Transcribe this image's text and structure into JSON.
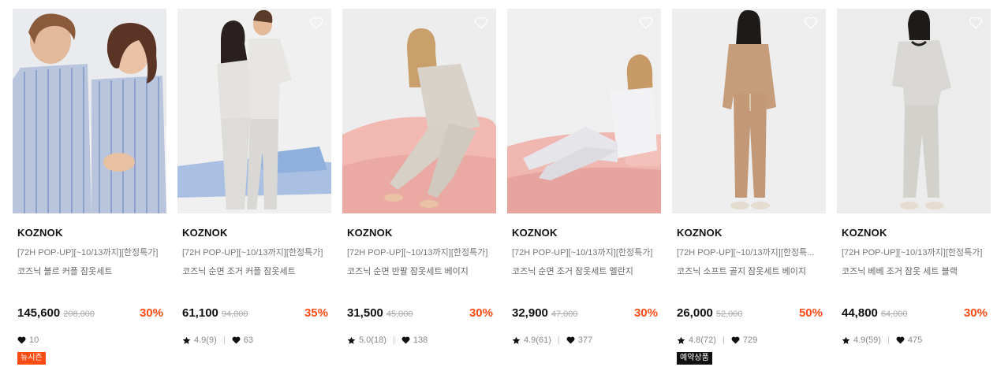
{
  "accent_color": "#ff4b14",
  "products": [
    {
      "brand": "KOZNOK",
      "tag": "[72H POP-UP][~10/13까지][한정특가]",
      "name": "코즈닉 블르 커플 잠옷세트",
      "price": "145,600",
      "original_price": "208,000",
      "discount": "30%",
      "rating": "",
      "likes": "10",
      "badge": "뉴시즌",
      "badge_color": "#ff4b14"
    },
    {
      "brand": "KOZNOK",
      "tag": "[72H POP-UP][~10/13까지][한정특가]",
      "name": "코즈닉 순면 조거 커플 잠옷세트",
      "price": "61,100",
      "original_price": "94,000",
      "discount": "35%",
      "rating": "4.9(9)",
      "likes": "63",
      "badge": ""
    },
    {
      "brand": "KOZNOK",
      "tag": "[72H POP-UP][~10/13까지][한정특가]",
      "name": "코즈닉 순면 반팔 잠옷세트 베이지",
      "price": "31,500",
      "original_price": "45,000",
      "discount": "30%",
      "rating": "5.0(18)",
      "likes": "138",
      "badge": ""
    },
    {
      "brand": "KOZNOK",
      "tag": "[72H POP-UP][~10/13까지][한정특가]",
      "name": "코즈닉 순면 조거 잠옷세트 멜란지",
      "price": "32,900",
      "original_price": "47,000",
      "discount": "30%",
      "rating": "4.9(61)",
      "likes": "377",
      "badge": ""
    },
    {
      "brand": "KOZNOK",
      "tag": "[72H POP-UP][~10/13까지][한정특...",
      "name": "코즈닉 소프트 골지 잠옷세트 베이지",
      "price": "26,000",
      "original_price": "52,000",
      "discount": "50%",
      "rating": "4.8(72)",
      "likes": "729",
      "badge": "예약상품",
      "badge_color": "#111111"
    },
    {
      "brand": "KOZNOK",
      "tag": "[72H POP-UP][~10/13까지][한정특가]",
      "name": "코즈닉 베베 조거 잠옷 세트 블랙",
      "price": "44,800",
      "original_price": "64,000",
      "discount": "30%",
      "rating": "4.9(59)",
      "likes": "475",
      "badge": ""
    }
  ]
}
